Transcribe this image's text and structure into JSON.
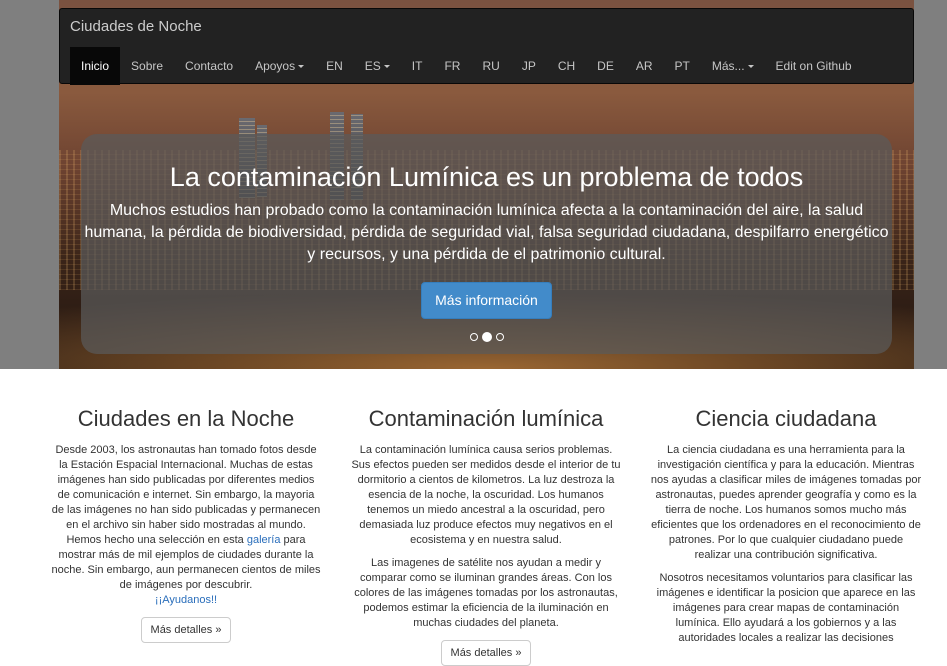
{
  "navbar": {
    "brand": "Ciudades de Noche",
    "items": [
      {
        "label": "Inicio"
      },
      {
        "label": "Sobre"
      },
      {
        "label": "Contacto"
      },
      {
        "label": "Apoyos"
      },
      {
        "label": "EN"
      },
      {
        "label": "ES"
      },
      {
        "label": "IT"
      },
      {
        "label": "FR"
      },
      {
        "label": "RU"
      },
      {
        "label": "JP"
      },
      {
        "label": "CH"
      },
      {
        "label": "DE"
      },
      {
        "label": "AR"
      },
      {
        "label": "PT"
      },
      {
        "label": "Más..."
      },
      {
        "label": "Edit on Github"
      }
    ]
  },
  "carousel": {
    "title": "La contaminación Lumínica es un problema de todos",
    "text": "Muchos estudios han probado como la contaminación lumínica afecta a la contaminación del aire, la salud humana, la pérdida de biodiversidad, pérdida de seguridad vial, falsa seguridad ciudadana, despilfarro energético y recursos, y una pérdida de el patrimonio cultural.",
    "button": "Más información",
    "slides_total": 3,
    "active_slide": 2
  },
  "columns": [
    {
      "title": "Ciudades en la Noche",
      "p1_before": "Desde 2003, los astronautas han tomado fotos desde la Estación Espacial Internacional. Muchas de estas imágenes han sido publicadas por diferentes medios de comunicación e internet. Sin embargo, la mayoria de las imágenes no han sido publicadas y permanecen en el archivo sin haber sido mostradas al mundo. Hemos hecho una selección en esta ",
      "p1_link": "galería",
      "p1_after": " para mostrar más de mil ejemplos de ciudades durante la noche. Sin embargo, aun permanecen cientos de miles de imágenes por descubrir.",
      "p1_cta": "¡¡Ayudanos!!",
      "button": "Más detalles »"
    },
    {
      "title": "Contaminación lumínica",
      "p1": "La contaminación lumínica causa serios problemas. Sus efectos pueden ser medidos desde el interior de tu dormitorio a cientos de kilometros. La luz destroza la esencia de la noche, la oscuridad. Los humanos tenemos un miedo ancestral a la oscuridad, pero demasiada luz produce efectos muy negativos en el ecosistema y en nuestra salud.",
      "p2": "Las imagenes de satélite nos ayudan a medir y comparar como se iluminan grandes áreas. Con los colores de las imágenes tomadas por los astronautas, podemos estimar la eficiencia de la iluminación en muchas ciudades del planeta.",
      "button": "Más detalles »"
    },
    {
      "title": "Ciencia ciudadana",
      "p1": "La ciencia ciudadana es una herramienta para la investigación científica y para la educación. Mientras nos ayudas a clasificar miles de imágenes tomadas por astronautas, puedes aprender geografía y como es la tierra de noche. Los humanos somos mucho más eficientes que los ordenadores en el reconocimiento de patrones. Por lo que cualquier ciudadano puede realizar una contribución significativa.",
      "p2": "Nosotros necesitamos voluntarios para clasificar las imágenes e identificar la posicion que aparece en las imágenes para crear mapas de contaminación lumínica. Ello ayudará a los gobiernos y a las autoridades locales a realizar las decisiones"
    }
  ]
}
